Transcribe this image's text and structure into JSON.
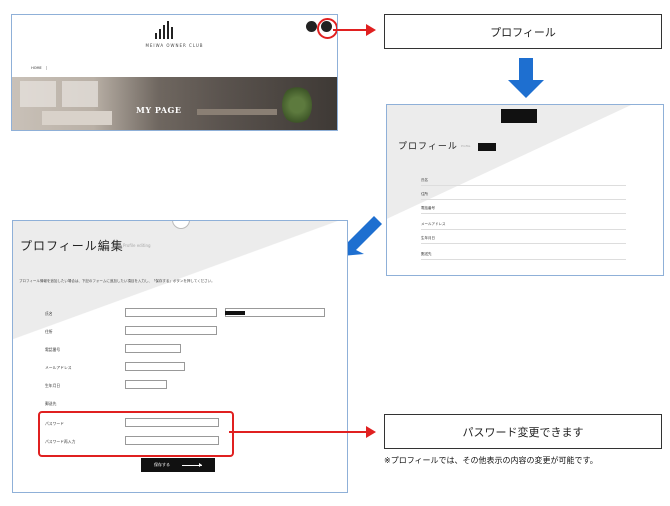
{
  "top_site": {
    "logo_text": "MEIWA OWNER CLUB",
    "nav": [
      "HOME",
      "",
      "",
      "",
      "",
      "",
      "",
      ""
    ],
    "hero_title": "MY PAGE"
  },
  "callouts": {
    "profile_label": "プロフィール",
    "password_label": "パスワード変更できます",
    "bottom_note": "※プロフィールでは、その他表示の内容の変更が可能です。"
  },
  "profile_view": {
    "title": "プロフィール",
    "title_en": "Profile",
    "rows": [
      {
        "label": "氏名",
        "value": ""
      },
      {
        "label": "住所",
        "value": ""
      },
      {
        "label": "電話番号",
        "value": ""
      },
      {
        "label": "メールアドレス",
        "value": ""
      },
      {
        "label": "生年月日",
        "value": ""
      },
      {
        "label": "郵送先",
        "value": ""
      }
    ]
  },
  "profile_edit": {
    "title": "プロフィール編集",
    "title_en": "Profile editing",
    "note": "プロフィール情報を追加したい場合は、下記のフォームに追加したい項目を入力し、「保存する」ボタンを押してください。",
    "rows": [
      {
        "label": "氏名",
        "value": ""
      },
      {
        "label": "住所",
        "value": ""
      },
      {
        "label": "電話番号",
        "value": ""
      },
      {
        "label": "メールアドレス",
        "value": ""
      },
      {
        "label": "生年月日",
        "value": ""
      },
      {
        "label": "郵送先",
        "value": ""
      },
      {
        "label": "パスワード",
        "value": ""
      },
      {
        "label": "パスワード再入力",
        "value": ""
      }
    ],
    "submit_label": "保存する"
  },
  "colors": {
    "accent_red": "#e02020",
    "arrow_blue": "#1e6fd0",
    "frame_blue": "#8fb0d8"
  }
}
